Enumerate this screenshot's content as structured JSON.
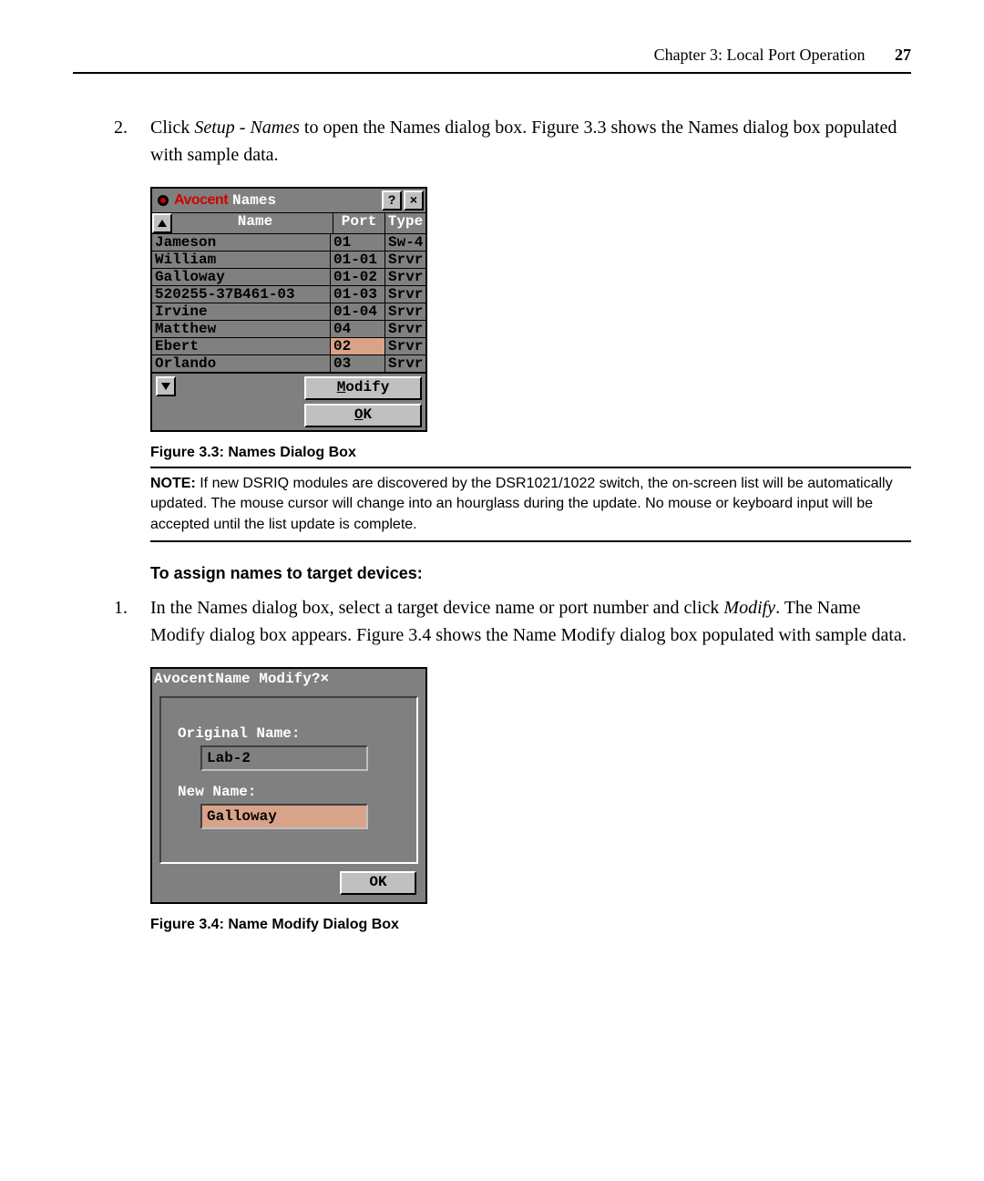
{
  "header": {
    "chapter_title": "Chapter 3: Local Port Operation",
    "page_number": "27"
  },
  "step2": {
    "number": "2.",
    "text_prefix": "Click ",
    "item1": "Setup",
    "dash": " - ",
    "item2": "Names",
    "text_suffix": " to open the Names dialog box. Figure 3.3 shows the Names dialog box populated with sample data."
  },
  "names_dialog": {
    "brand": "Avocent",
    "title": "Names",
    "help_btn": "?",
    "close_btn": "×",
    "cols": {
      "name": "Name",
      "port": "Port",
      "type": "Type"
    },
    "rows": [
      {
        "name": "Jameson",
        "port": "01",
        "type": "Sw-4",
        "selected": false
      },
      {
        "name": "William",
        "port": "01-01",
        "type": "Srvr",
        "selected": false
      },
      {
        "name": "Galloway",
        "port": "01-02",
        "type": "Srvr",
        "selected": false
      },
      {
        "name": "520255-37B461-03",
        "port": "01-03",
        "type": "Srvr",
        "selected": false
      },
      {
        "name": "Irvine",
        "port": "01-04",
        "type": "Srvr",
        "selected": false
      },
      {
        "name": "Matthew",
        "port": "04",
        "type": "Srvr",
        "selected": false
      },
      {
        "name": "Ebert",
        "port": "02",
        "type": "Srvr",
        "selected": true
      },
      {
        "name": "Orlando",
        "port": "03",
        "type": "Srvr",
        "selected": false
      }
    ],
    "modify_btn": {
      "accel": "M",
      "rest": "odify"
    },
    "ok_btn": {
      "accel": "O",
      "rest": "K"
    }
  },
  "fig33_caption": "Figure 3.3: Names Dialog Box",
  "note": {
    "label": "NOTE:",
    "text": "  If new DSRIQ modules are discovered by the DSR1021/1022 switch, the on-screen list will be automatically updated. The mouse cursor will change into an hourglass during the update. No mouse or keyboard input will be accepted until the list update is complete."
  },
  "subhead": "To assign names to target devices:",
  "step1": {
    "number": "1.",
    "text_prefix": "In the Names dialog box, select a target device name or port number and click ",
    "item1": "Modify",
    "text_mid": ". The Name Modify dialog box appears. Figure 3.4 shows the Name Modify dialog box populated with sample data."
  },
  "modify_dialog": {
    "brand": "Avocent",
    "title": "Name Modify",
    "help_btn": "?",
    "close_btn": "×",
    "orig_label": "Original Name:",
    "orig_value": "Lab-2",
    "new_label": "New Name:",
    "new_value": "Galloway",
    "ok_btn": {
      "accel": "O",
      "rest": "K"
    }
  },
  "fig34_caption": "Figure 3.4: Name Modify Dialog Box"
}
